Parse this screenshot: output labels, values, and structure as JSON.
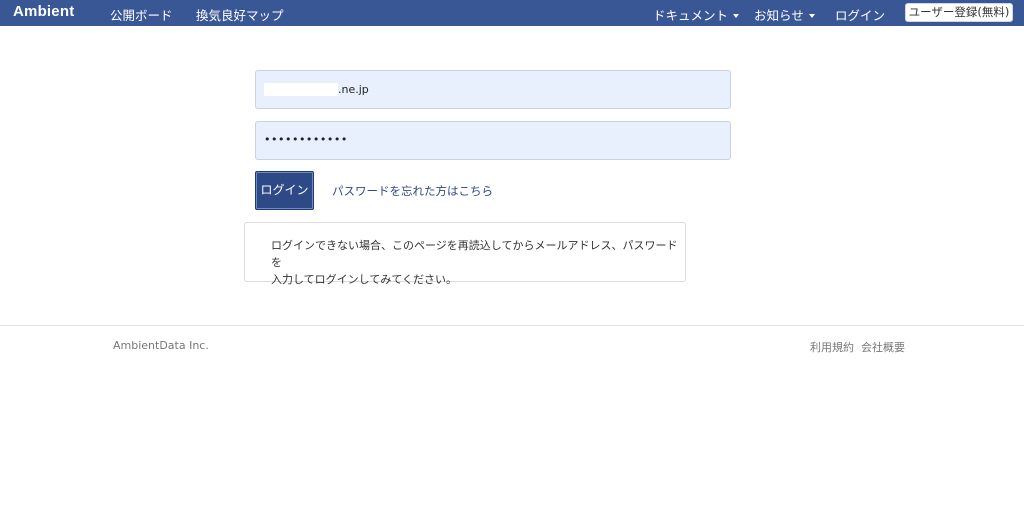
{
  "navbar": {
    "brand": "Ambient",
    "left_links": [
      "公開ボード",
      "換気良好マップ"
    ],
    "documents_label": "ドキュメント",
    "news_label": "お知らせ",
    "login_label": "ログイン",
    "signup_label": "ユーザー登録(無料)",
    "background_color": "#3a5795"
  },
  "form": {
    "email_value": ".ne.jp",
    "password_value": "••••••••••••",
    "login_button": "ログイン",
    "forgot_password": "パスワードを忘れた方はこちら",
    "notice_lines": [
      "ログインできない場合、このページを再読込してからメールアドレス、パスワードを",
      "入力してログインしてみてください。"
    ]
  },
  "footer": {
    "company": "AmbientData Inc.",
    "terms": "利用規約",
    "about": "会社概要"
  }
}
